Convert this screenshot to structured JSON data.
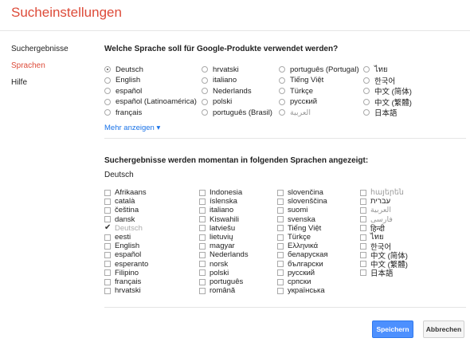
{
  "header": {
    "title": "Sucheinstellungen"
  },
  "sidebar": {
    "items": [
      {
        "label": "Suchergebnisse",
        "active": false
      },
      {
        "label": "Sprachen",
        "active": true
      },
      {
        "label": "Hilfe",
        "active": false
      }
    ]
  },
  "section1": {
    "heading": "Welche Sprache soll für Google-Produkte verwendet werden?",
    "columns": [
      [
        "Deutsch",
        "English",
        "español",
        "español (Latinoamérica)",
        "français"
      ],
      [
        "hrvatski",
        "italiano",
        "Nederlands",
        "polski",
        "português (Brasil)"
      ],
      [
        "português (Portugal)",
        "Tiếng Việt",
        "Türkçe",
        "русский",
        "العربية"
      ],
      [
        "ไทย",
        "한국어",
        "中文 (简体)",
        "中文 (繁體)",
        "日本語"
      ]
    ],
    "selected": "Deutsch",
    "more_label": "Mehr anzeigen"
  },
  "section2": {
    "heading": "Suchergebnisse werden momentan in folgenden Sprachen angezeigt:",
    "current": "Deutsch",
    "columns": [
      [
        "Afrikaans",
        "català",
        "čeština",
        "dansk",
        "Deutsch",
        "eesti",
        "English",
        "español",
        "esperanto",
        "Filipino",
        "français",
        "hrvatski"
      ],
      [
        "Indonesia",
        "íslenska",
        "italiano",
        "Kiswahili",
        "latviešu",
        "lietuvių",
        "magyar",
        "Nederlands",
        "norsk",
        "polski",
        "português",
        "română"
      ],
      [
        "slovenčina",
        "slovenščina",
        "suomi",
        "svenska",
        "Tiếng Việt",
        "Türkçe",
        "Ελληνικά",
        "беларуская",
        "български",
        "русский",
        "српски",
        "українська"
      ],
      [
        "հայերեն",
        "עברית",
        "العربية",
        "فارسی",
        "हिन्दी",
        "ไทย",
        "한국어",
        "中文 (简体)",
        "中文 (繁體)",
        "日本語"
      ]
    ],
    "checked": [
      "Deutsch"
    ],
    "muted": [
      "հայերեն",
      "العربية",
      "فارسی"
    ]
  },
  "buttons": {
    "save": "Speichern",
    "cancel": "Abbrechen"
  }
}
